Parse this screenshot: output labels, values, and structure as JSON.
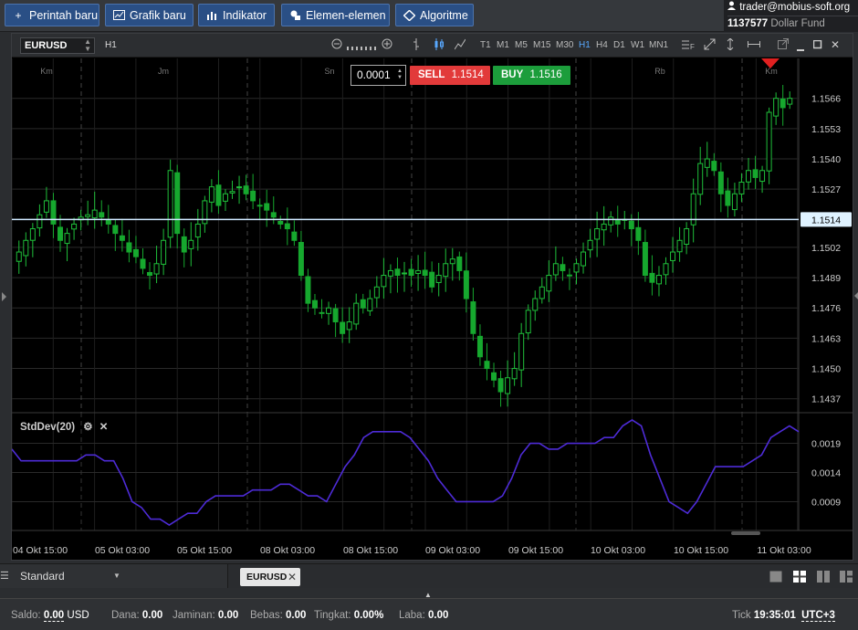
{
  "toolbar": {
    "buttons": [
      {
        "label": "Perintah baru",
        "icon": "plus-icon"
      },
      {
        "label": "Grafik baru",
        "icon": "chart-icon"
      },
      {
        "label": "Indikator",
        "icon": "bar-chart-icon"
      },
      {
        "label": "Elemen-elemen",
        "icon": "shapes-icon"
      },
      {
        "label": "Algoritme",
        "icon": "diamond-icon"
      }
    ]
  },
  "account": {
    "user": "trader@mobius-soft.org",
    "number": "1137577",
    "fund": "Dollar Fund"
  },
  "chart_toolbar": {
    "symbol": "EURUSD",
    "timeframe": "H1",
    "timeframes": [
      "T1",
      "M1",
      "M5",
      "M15",
      "M30",
      "H1",
      "H4",
      "D1",
      "W1",
      "MN1"
    ],
    "active_timeframe": "H1"
  },
  "trade": {
    "lot": "0.0001",
    "sell_label": "SELL",
    "sell_price": "1.1514",
    "buy_label": "BUY",
    "buy_price": "1.1516"
  },
  "chart_data": {
    "type": "candlestick",
    "symbol": "EURUSD",
    "timeframe": "H1",
    "price_axis_ticks": [
      "1.1566",
      "1.1553",
      "1.1540",
      "1.1527",
      "1.1514",
      "1.1502",
      "1.1489",
      "1.1476",
      "1.1463",
      "1.1450",
      "1.1437"
    ],
    "current_price_label": "1.1514",
    "current_price": 1.1514,
    "ylim": [
      1.1431,
      1.158
    ],
    "day_labels": [
      "Km",
      "Jm",
      "Sn",
      "Rb",
      "Km"
    ],
    "time_axis_labels": [
      "04 Okt 15:00",
      "05 Okt 03:00",
      "05 Okt 15:00",
      "08 Okt 03:00",
      "08 Okt 15:00",
      "09 Okt 03:00",
      "09 Okt 15:00",
      "10 Okt 03:00",
      "10 Okt 15:00",
      "11 Okt 03:00"
    ],
    "close_path": [
      1.15,
      1.1505,
      1.151,
      1.1516,
      1.1522,
      1.1512,
      1.1505,
      1.1508,
      1.1512,
      1.1515,
      1.1516,
      1.1518,
      1.1515,
      1.1512,
      1.1508,
      1.1505,
      1.15,
      1.1498,
      1.1493,
      1.149,
      1.1495,
      1.1505,
      1.1535,
      1.1508,
      1.15,
      1.1505,
      1.1512,
      1.1522,
      1.1528,
      1.152,
      1.1525,
      1.1526,
      1.1528,
      1.1525,
      1.1522,
      1.152,
      1.1518,
      1.1515,
      1.1512,
      1.151,
      1.1505,
      1.149,
      1.1478,
      1.1476,
      1.1474,
      1.1476,
      1.147,
      1.1465,
      1.147,
      1.1478,
      1.1476,
      1.148,
      1.1485,
      1.149,
      1.1492,
      1.149,
      1.1491,
      1.149,
      1.1492,
      1.149,
      1.1485,
      1.149,
      1.1495,
      1.1497,
      1.1492,
      1.148,
      1.1465,
      1.1455,
      1.145,
      1.1445,
      1.144,
      1.1446,
      1.145,
      1.1465,
      1.1475,
      1.148,
      1.1485,
      1.149,
      1.1495,
      1.1492,
      1.149,
      1.1495,
      1.15,
      1.1505,
      1.151,
      1.1512,
      1.1515,
      1.1512,
      1.1514,
      1.151,
      1.1505,
      1.149,
      1.1487,
      1.149,
      1.1495,
      1.15,
      1.1505,
      1.151,
      1.1525,
      1.1538,
      1.154,
      1.1535,
      1.1525,
      1.152,
      1.1525,
      1.153,
      1.1535,
      1.1532,
      1.1535,
      1.156,
      1.1566,
      1.1562,
      1.1566
    ],
    "indicator": {
      "name": "StdDev(20)",
      "ticks": [
        "0.0019",
        "0.0014",
        "0.0009"
      ],
      "ylim": [
        0.0005,
        0.0023
      ],
      "values": [
        0.0018,
        0.0016,
        0.0016,
        0.0016,
        0.0016,
        0.0016,
        0.0016,
        0.0016,
        0.0017,
        0.0017,
        0.0016,
        0.0016,
        0.0013,
        0.0009,
        0.0008,
        0.0006,
        0.0006,
        0.0005,
        0.0006,
        0.0007,
        0.0007,
        0.0009,
        0.001,
        0.001,
        0.001,
        0.001,
        0.0011,
        0.0011,
        0.0011,
        0.0012,
        0.0012,
        0.0011,
        0.001,
        0.001,
        0.0009,
        0.0012,
        0.0015,
        0.0017,
        0.002,
        0.0021,
        0.0021,
        0.0021,
        0.0021,
        0.002,
        0.0018,
        0.0016,
        0.0013,
        0.0011,
        0.0009,
        0.0009,
        0.0009,
        0.0009,
        0.0009,
        0.001,
        0.0013,
        0.0017,
        0.0019,
        0.0019,
        0.0018,
        0.0018,
        0.0019,
        0.0019,
        0.0019,
        0.0019,
        0.002,
        0.002,
        0.0022,
        0.0023,
        0.0022,
        0.0017,
        0.0013,
        0.0009,
        0.0008,
        0.0007,
        0.0009,
        0.0012,
        0.0015,
        0.0015,
        0.0015,
        0.0015,
        0.0016,
        0.0017,
        0.002,
        0.0021,
        0.0022,
        0.0021
      ]
    }
  },
  "tabs": {
    "layout": "Standard",
    "chart_tab": "EURUSD"
  },
  "status": {
    "saldo_label": "Saldo:",
    "saldo_value": "0.00",
    "saldo_ccy": "USD",
    "dana_label": "Dana:",
    "dana_value": "0.00",
    "jaminan_label": "Jaminan:",
    "jaminan_value": "0.00",
    "bebas_label": "Bebas:",
    "bebas_value": "0.00",
    "tingkat_label": "Tingkat:",
    "tingkat_value": "0.00%",
    "laba_label": "Laba:",
    "laba_value": "0.00",
    "tick_label": "Tick",
    "time": "19:35:01",
    "tz": "UTC+3"
  },
  "colors": {
    "bull": "#1fbf3a",
    "bear": "#16a82e",
    "indicator": "#4d2bd6",
    "sell": "#e23a3a",
    "buy": "#1c9d3b",
    "accent": "#2a4f85"
  }
}
